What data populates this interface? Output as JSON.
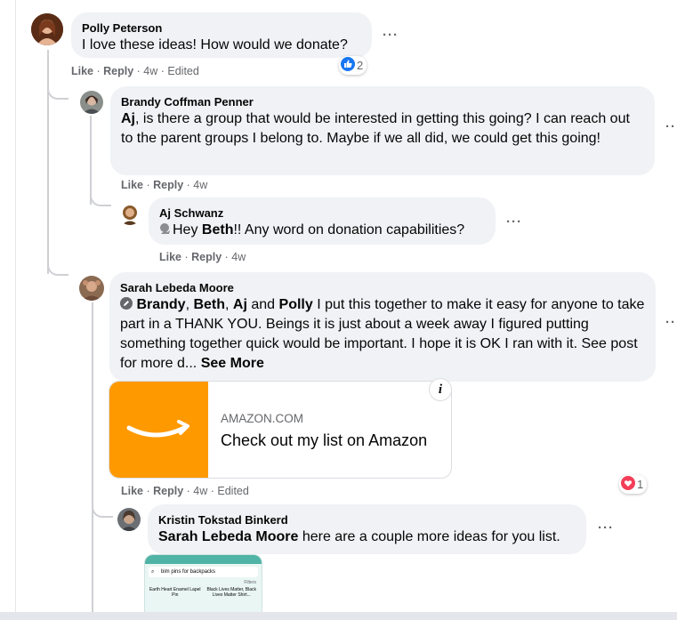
{
  "comments": [
    {
      "name": "Polly Peterson",
      "text": "I love these ideas! How would we donate?",
      "like": "Like",
      "reply": "Reply",
      "time": "4w",
      "edited": "Edited",
      "reactions": "2"
    },
    {
      "name": "Brandy Coffman Penner",
      "mention": "Aj",
      "text": ", is there a group that would be interested in getting this going? I can reach out to the parent groups I belong to. Maybe if we all did, we could get this going!",
      "like": "Like",
      "reply": "Reply",
      "time": "4w"
    },
    {
      "name": "Aj Schwanz",
      "pre": "Hey ",
      "mention": "Beth",
      "text": "!! Any word on donation capabilities?",
      "like": "Like",
      "reply": "Reply",
      "time": "4w"
    },
    {
      "name": "Sarah Lebeda Moore",
      "m1": "Brandy",
      "m2": "Beth",
      "m3": "Aj",
      "and": "and",
      "m4": "Polly",
      "text": " I put this together to make it easy for anyone to take part in a THANK YOU. Beings it is just about a week away I figured putting something together quick would be important. I hope it is OK I ran with it. See post for more d... ",
      "see_more": "See More",
      "like": "Like",
      "reply": "Reply",
      "time": "4w",
      "edited": "Edited",
      "reactions": "1"
    },
    {
      "name": "Kristin Tokstad Binkerd",
      "mention": "Sarah Lebeda Moore",
      "text": " here are a couple more ideas for you list."
    }
  ],
  "link_preview": {
    "domain": "AMAZON.COM",
    "title": "Check out my list on Amazon",
    "info": "i"
  },
  "thumbnail": {
    "search": "bim pins for backpacks",
    "filters": "Filters",
    "item1": "Earth Heart Enamel Lapel Pin",
    "item2": "Black Lives Matter, Black Lives Matter Shirt..."
  },
  "ui": {
    "more": "···",
    "sep": " · "
  }
}
